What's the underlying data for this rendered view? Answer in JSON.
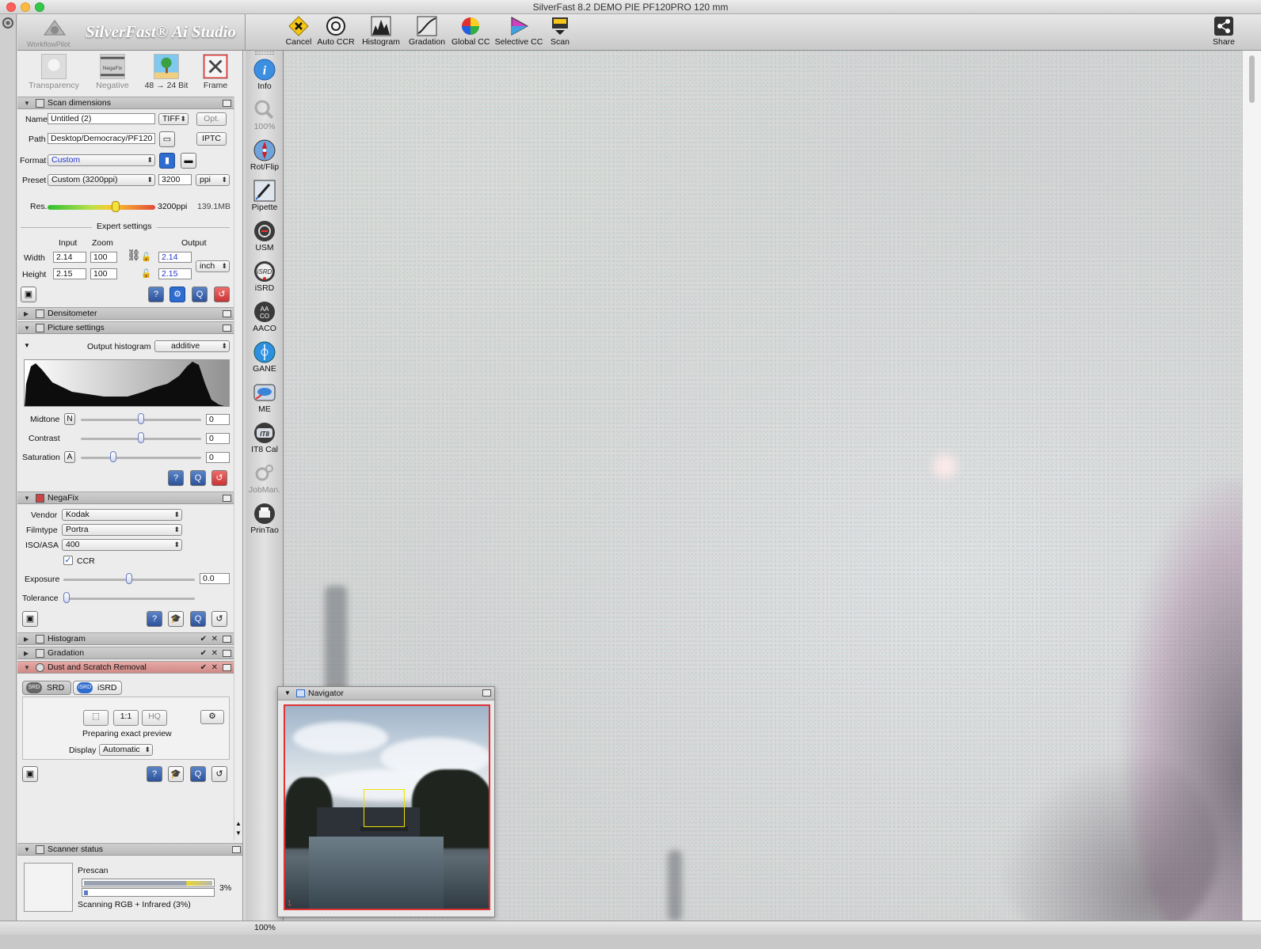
{
  "window": {
    "title": "SilverFast 8.2 DEMO  PIE PF120PRO 120 mm"
  },
  "logo": {
    "brand": "SilverFast® Ai Studio",
    "workflow_pilot": "WorkflowPilot"
  },
  "toolbar": {
    "buttons": [
      {
        "label": "Cancel",
        "icon": "cancel-icon"
      },
      {
        "label": "Auto CCR",
        "icon": "auto-ccr-icon"
      },
      {
        "label": "Histogram",
        "icon": "histogram-icon"
      },
      {
        "label": "Gradation",
        "icon": "gradation-icon"
      },
      {
        "label": "Global CC",
        "icon": "global-cc-icon"
      },
      {
        "label": "Selective CC",
        "icon": "selective-cc-icon"
      },
      {
        "label": "Scan",
        "icon": "scan-icon"
      }
    ],
    "share": "Share"
  },
  "modes": {
    "transparency": "Transparency",
    "negative": "Negative",
    "negafix_text": "NegaFix",
    "bitdepth": "48 → 24 Bit",
    "frame": "Frame"
  },
  "scan_dimensions": {
    "title": "Scan dimensions",
    "name_label": "Name",
    "name_value": "Untitled (2)",
    "filetype": "TIFF",
    "opt": "Opt.",
    "path_label": "Path",
    "path_value": "Desktop/Democracy/PF120",
    "iptc": "IPTC",
    "format_label": "Format",
    "format_value": "Custom",
    "preset_label": "Preset",
    "preset_value": "Custom (3200ppi)",
    "ppi_value": "3200",
    "ppi_unit": "ppi",
    "res_label": "Res.",
    "res_value": "3200ppi",
    "file_size": "139.1MB",
    "res_level": 0.64,
    "expert_settings": "Expert settings",
    "input_h": "Input",
    "zoom_h": "Zoom",
    "output_h": "Output",
    "width_label": "Width",
    "width_in": "2.14",
    "width_zoom": "100",
    "width_out": "2.14",
    "height_label": "Height",
    "height_in": "2.15",
    "height_zoom": "100",
    "height_out": "2.15",
    "unit": "inch"
  },
  "densitometer": {
    "title": "Densitometer"
  },
  "picture_settings": {
    "title": "Picture settings",
    "output_histogram_label": "Output histogram",
    "output_histogram_value": "additive",
    "midtone_label": "Midtone",
    "midtone_mode": "N",
    "midtone_value": "0",
    "midtone_level": 0.5,
    "contrast_label": "Contrast",
    "contrast_value": "0",
    "contrast_level": 0.5,
    "saturation_label": "Saturation",
    "saturation_mode": "A",
    "saturation_value": "0",
    "saturation_level": 0.26
  },
  "negafix": {
    "title": "NegaFix",
    "vendor_label": "Vendor",
    "vendor_value": "Kodak",
    "filmtype_label": "Filmtype",
    "filmtype_value": "Portra",
    "iso_label": "ISO/ASA",
    "iso_value": "400",
    "ccr_label": "CCR",
    "ccr_checked": true,
    "exposure_label": "Exposure",
    "exposure_value": "0.0",
    "exposure_level": 0.5,
    "tolerance_label": "Tolerance",
    "tolerance_level": 0.0
  },
  "collapsed_sections": {
    "histogram": "Histogram",
    "gradation": "Gradation"
  },
  "dust": {
    "title": "Dust and Scratch Removal",
    "tab_srd": "SRD",
    "tab_isrd": "iSRD",
    "one_to_one": "1:1",
    "hq": "HQ",
    "preparing": "Preparing exact preview",
    "display_label": "Display",
    "display_value": "Automatic"
  },
  "scanner_status": {
    "title": "Scanner status",
    "phase": "Prescan",
    "percent": "3%",
    "message": "Scanning RGB + Infrared (3%)"
  },
  "vtools": [
    {
      "label": "Info",
      "icon": "info-icon",
      "dim": false
    },
    {
      "label": "100%",
      "icon": "zoom-icon",
      "dim": true
    },
    {
      "label": "Rot/Flip",
      "icon": "rotate-flip-icon",
      "dim": false
    },
    {
      "label": "Pipette",
      "icon": "pipette-icon",
      "dim": false
    },
    {
      "label": "USM",
      "icon": "usm-icon",
      "dim": false
    },
    {
      "label": "iSRD",
      "icon": "isrd-icon",
      "dim": false
    },
    {
      "label": "AACO",
      "icon": "aaco-icon",
      "dim": false
    },
    {
      "label": "GANE",
      "icon": "gane-icon",
      "dim": false
    },
    {
      "label": "ME",
      "icon": "me-icon",
      "dim": false
    },
    {
      "label": "IT8 Cal",
      "icon": "it8-cal-icon",
      "dim": false
    },
    {
      "label": "JobMan.",
      "icon": "jobman-icon",
      "dim": true
    },
    {
      "label": "PrinTao",
      "icon": "printao-icon",
      "dim": false
    }
  ],
  "navigator": {
    "title": "Navigator",
    "frame_number": "1"
  },
  "statusbar": {
    "zoom": "100%"
  },
  "colors": {
    "accent": "#2f6ccf",
    "frame_red": "#dd3333",
    "nav_rect": "#f0e000"
  }
}
